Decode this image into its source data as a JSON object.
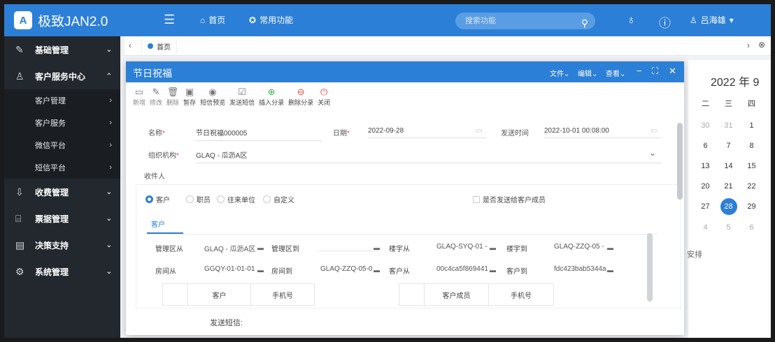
{
  "app": {
    "logo_mark": "A",
    "title": "极致JAN2.0"
  },
  "topnav": {
    "home": "首页",
    "common": "常用功能",
    "search_placeholder": "搜索功能",
    "user": "吕海雄"
  },
  "sidebar": {
    "items": [
      {
        "label": "基础管理",
        "icon": "edit-icon"
      },
      {
        "label": "客户服务中心",
        "icon": "user-icon"
      },
      {
        "label": "收费管理",
        "icon": "download-icon"
      },
      {
        "label": "票据管理",
        "icon": "ticket-icon"
      },
      {
        "label": "决策支持",
        "icon": "chart-icon"
      },
      {
        "label": "系统管理",
        "icon": "gear-icon"
      }
    ],
    "subitems": [
      "客户管理",
      "客户服务",
      "微信平台",
      "短信平台"
    ]
  },
  "tabs": {
    "home": "首页"
  },
  "calendar": {
    "title": "2022 年 9",
    "weekdays": [
      "二",
      "三",
      "四"
    ],
    "rows": [
      [
        "30",
        "31",
        "1"
      ],
      [
        "6",
        "7",
        "8"
      ],
      [
        "13",
        "14",
        "15"
      ],
      [
        "20",
        "21",
        "22"
      ],
      [
        "27",
        "28",
        "29"
      ],
      [
        "4",
        "5",
        "6"
      ]
    ],
    "today": "28",
    "note": "安排"
  },
  "dialog": {
    "title": "节日祝福",
    "menu": {
      "file": "文件",
      "edit": "编辑",
      "view": "查看"
    },
    "toolbar": [
      "新增",
      "修改",
      "删除",
      "暂存",
      "短信预览",
      "发送短信",
      "插入分录",
      "删除分录",
      "关闭"
    ],
    "form": {
      "name_label": "名称",
      "name_value": "节日祝福000005",
      "date_label": "日期",
      "date_value": "2022-09-28",
      "sendtime_label": "发送时间",
      "sendtime_value": "2022-10-01 00:08:00",
      "org_label": "组织机构",
      "org_value": "GLAQ - 瓜沥A区",
      "recipient_label": "收件人"
    },
    "radios": [
      "客户",
      "职员",
      "往来单位",
      "自定义"
    ],
    "checkbox": "是否发送给客户成员",
    "subtab": "客户",
    "query": {
      "area_from_label": "管理区从",
      "area_from_value": "GLAQ - 瓜沥A区",
      "area_to_label": "管理区到",
      "building_from_label": "楼宇从",
      "building_from_value": "GLAQ-SYQ-01 -",
      "building_to_label": "楼宇到",
      "building_to_value": "GLAQ-ZZQ-05 -",
      "room_from_label": "房间从",
      "room_from_value": "GGQY-01-01-01",
      "room_to_label": "房间到",
      "room_to_value": "GLAQ-ZZQ-05-0",
      "cust_from_label": "客户从",
      "cust_from_value": "00c4ca5f869441",
      "cust_to_label": "客户到",
      "cust_to_value": "fdc423bab5344a"
    },
    "grid_left": [
      "客户",
      "手机号"
    ],
    "grid_right": [
      "客户成员",
      "手机号"
    ],
    "sms_label": "发送短信:"
  }
}
